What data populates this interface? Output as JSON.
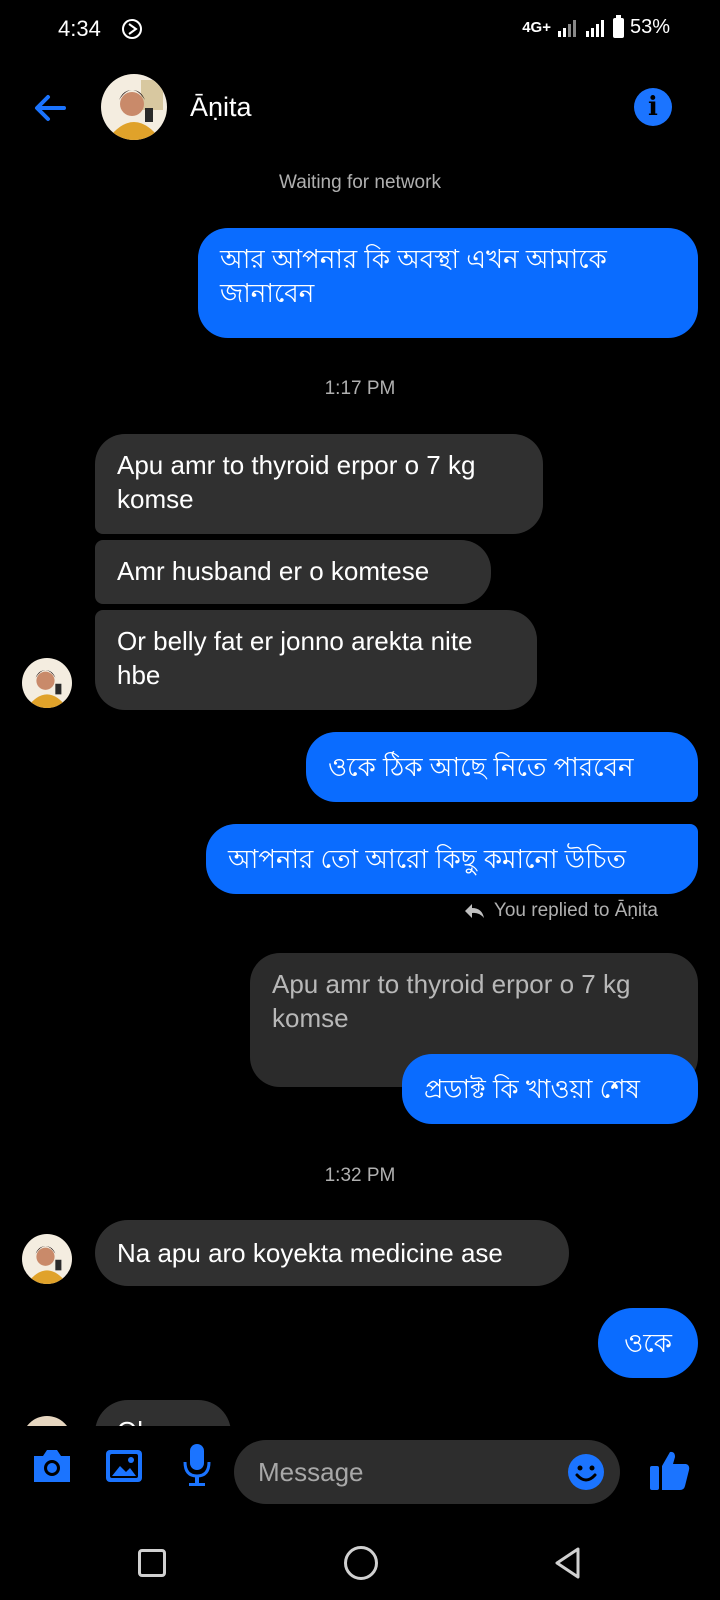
{
  "status_bar": {
    "time": "4:34",
    "network": "4G+",
    "battery": "53%"
  },
  "header": {
    "contact_name": "Āṇita"
  },
  "network_status": "Waiting for network",
  "timestamps": [
    "1:17 PM",
    "1:32 PM"
  ],
  "messages": {
    "m1": "আর আপনার কি অবস্থা এখন আমাকে জানাবেন",
    "m2": "Apu amr to thyroid erpor o 7 kg komse",
    "m3": "Amr husband er o komtese",
    "m4": "Or belly fat er jonno arekta nite hbe",
    "m5": "ওকে ঠিক আছে নিতে পারবেন",
    "m6": "আপনার তো আরো কিছু কমানো উচিত",
    "reply_note": "You replied to Āṇita",
    "quoted": "Apu amr to thyroid erpor o 7 kg komse",
    "m7": "প্রডাক্ট কি খাওয়া শেষ",
    "m8": "Na apu aro koyekta medicine ase",
    "m9": "ওকে",
    "m10_partial": "Ok"
  },
  "composer": {
    "placeholder": "Message"
  },
  "colors": {
    "accent": "#0a6cff",
    "incoming_bubble": "#303030",
    "background": "#000000"
  }
}
